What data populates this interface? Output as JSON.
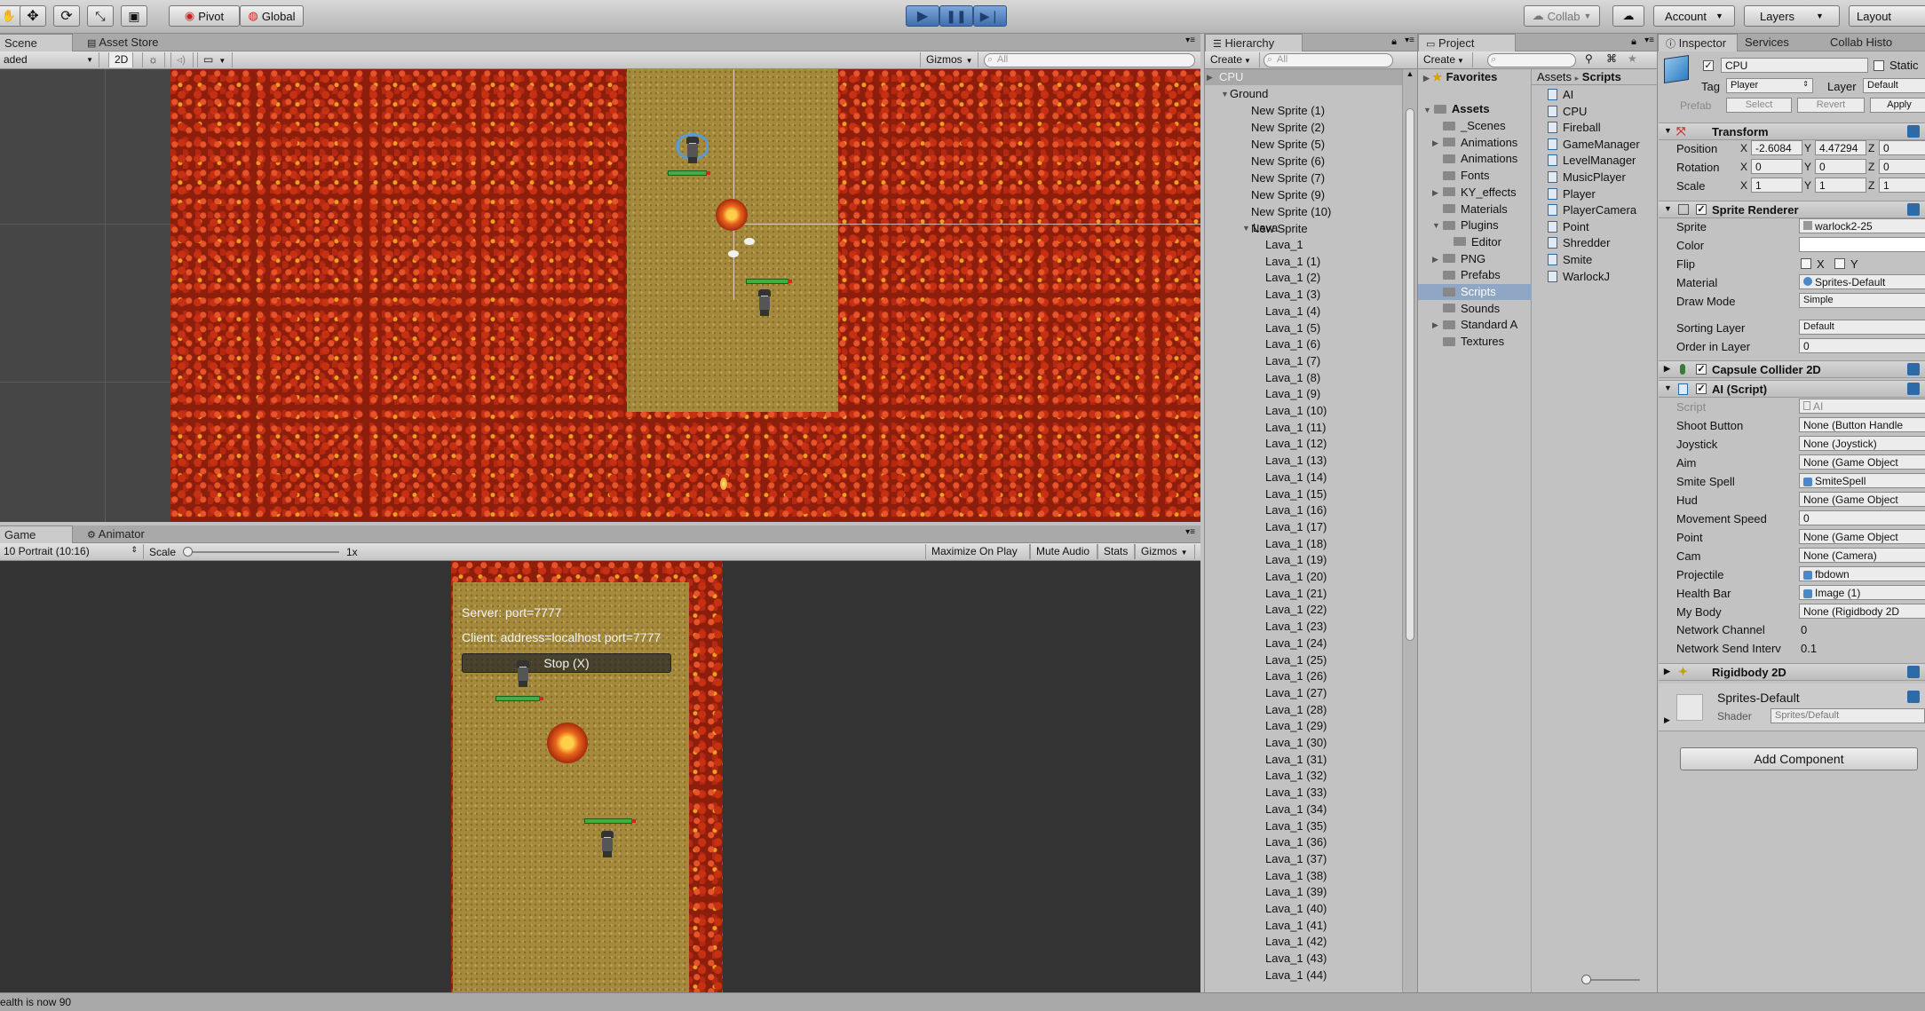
{
  "toolbar": {
    "pivot": "Pivot",
    "global": "Global",
    "collab": "Collab",
    "account": "Account",
    "layers": "Layers",
    "layout": "Layout"
  },
  "scene": {
    "tab_scene": "Scene",
    "tab_asset_store": "Asset Store",
    "shading_mode": "aded",
    "btn_2d": "2D",
    "gizmos": "Gizmos",
    "search_placeholder": "All"
  },
  "game": {
    "tab_game": "Game",
    "tab_animator": "Animator",
    "resolution": "10 Portrait (10:16)",
    "scale_label": "Scale",
    "scale_value": "1x",
    "maximize": "Maximize On Play",
    "mute": "Mute Audio",
    "stats": "Stats",
    "gizmos": "Gizmos",
    "server_text": "Server: port=7777",
    "client_text": "Client: address=localhost port=7777",
    "stop_button": "Stop (X)"
  },
  "hierarchy": {
    "tab": "Hierarchy",
    "create": "Create",
    "search_placeholder": "All",
    "cpu": "CPU",
    "ground": "Ground",
    "ground_items": [
      "New Sprite (1)",
      "New Sprite (2)",
      "New Sprite (5)",
      "New Sprite (6)",
      "New Sprite (7)",
      "New Sprite (9)",
      "New Sprite (10)",
      "New Sprite"
    ],
    "lava": "Lava",
    "lava_items": [
      "Lava_1",
      "Lava_1 (1)",
      "Lava_1 (2)",
      "Lava_1 (3)",
      "Lava_1 (4)",
      "Lava_1 (5)",
      "Lava_1 (6)",
      "Lava_1 (7)",
      "Lava_1 (8)",
      "Lava_1 (9)",
      "Lava_1 (10)",
      "Lava_1 (11)",
      "Lava_1 (12)",
      "Lava_1 (13)",
      "Lava_1 (14)",
      "Lava_1 (15)",
      "Lava_1 (16)",
      "Lava_1 (17)",
      "Lava_1 (18)",
      "Lava_1 (19)",
      "Lava_1 (20)",
      "Lava_1 (21)",
      "Lava_1 (22)",
      "Lava_1 (23)",
      "Lava_1 (24)",
      "Lava_1 (25)",
      "Lava_1 (26)",
      "Lava_1 (27)",
      "Lava_1 (28)",
      "Lava_1 (29)",
      "Lava_1 (30)",
      "Lava_1 (31)",
      "Lava_1 (32)",
      "Lava_1 (33)",
      "Lava_1 (34)",
      "Lava_1 (35)",
      "Lava_1 (36)",
      "Lava_1 (37)",
      "Lava_1 (38)",
      "Lava_1 (39)",
      "Lava_1 (40)",
      "Lava_1 (41)",
      "Lava_1 (42)",
      "Lava_1 (43)",
      "Lava_1 (44)"
    ]
  },
  "project": {
    "tab": "Project",
    "create": "Create",
    "favorites": "Favorites",
    "assets": "Assets",
    "breadcrumb_assets": "Assets",
    "breadcrumb_sep": "▸",
    "breadcrumb_scripts": "Scripts",
    "folders": [
      "_Scenes",
      "Animations",
      "Animations",
      "Fonts",
      "KY_effects",
      "Materials",
      "Plugins",
      "Editor",
      "PNG",
      "Prefabs",
      "Scripts",
      "Sounds",
      "Standard A",
      "Textures"
    ],
    "scripts": [
      "AI",
      "CPU",
      "Fireball",
      "GameManager",
      "LevelManager",
      "MusicPlayer",
      "Player",
      "PlayerCamera",
      "Point",
      "Shredder",
      "Smite",
      "WarlockJ"
    ]
  },
  "inspector": {
    "tab": "Inspector",
    "tab_services": "Services",
    "tab_collab": "Collab Histo",
    "object_name": "CPU",
    "static": "Static",
    "tag_label": "Tag",
    "tag_value": "Player",
    "layer_label": "Layer",
    "layer_value": "Default",
    "prefab_label": "Prefab",
    "prefab_select": "Select",
    "prefab_revert": "Revert",
    "prefab_apply": "Apply",
    "transform": {
      "title": "Transform",
      "position_label": "Position",
      "rotation_label": "Rotation",
      "scale_label": "Scale",
      "x": "X",
      "y": "Y",
      "z": "Z",
      "pos_x": "-2.6084",
      "pos_y": "4.47294",
      "pos_z": "0",
      "rot_x": "0",
      "rot_y": "0",
      "rot_z": "0",
      "scl_x": "1",
      "scl_y": "1",
      "scl_z": "1"
    },
    "sprite_renderer": {
      "title": "Sprite Renderer",
      "sprite_label": "Sprite",
      "sprite_value": "warlock2-25",
      "color_label": "Color",
      "flip_label": "Flip",
      "flip_x": "X",
      "flip_y": "Y",
      "material_label": "Material",
      "material_value": "Sprites-Default",
      "draw_mode_label": "Draw Mode",
      "draw_mode_value": "Simple",
      "sorting_layer_label": "Sorting Layer",
      "sorting_layer_value": "Default",
      "order_label": "Order in Layer",
      "order_value": "0"
    },
    "capsule_collider": {
      "title": "Capsule Collider 2D"
    },
    "ai_script": {
      "title": "AI (Script)",
      "script_label": "Script",
      "script_value": "AI",
      "fields": [
        {
          "label": "Shoot Button",
          "value": "None (Button Handle"
        },
        {
          "label": "Joystick",
          "value": "None (Joystick)"
        },
        {
          "label": "Aim",
          "value": "None (Game Object"
        },
        {
          "label": "Smite Spell",
          "value": "SmiteSpell"
        },
        {
          "label": "Hud",
          "value": "None (Game Object"
        },
        {
          "label": "Movement Speed",
          "value": "0"
        },
        {
          "label": "Point",
          "value": "None (Game Object"
        },
        {
          "label": "Cam",
          "value": "None (Camera)"
        },
        {
          "label": "Projectile",
          "value": "fbdown"
        },
        {
          "label": "Health Bar",
          "value": "Image (1)"
        },
        {
          "label": "My Body",
          "value": "None (Rigidbody 2D"
        }
      ],
      "network_channel_label": "Network Channel",
      "network_channel_value": "0",
      "network_send_label": "Network Send Interv",
      "network_send_value": "0.1"
    },
    "rigidbody": {
      "title": "Rigidbody 2D"
    },
    "material": {
      "name": "Sprites-Default",
      "shader_label": "Shader",
      "shader_value": "Sprites/Default"
    },
    "add_component": "Add Component"
  },
  "status_bar": {
    "message": "ealth is now 90"
  },
  "colors": {
    "selection": "#8fa6c4",
    "panel_bg": "#c2c2c2",
    "lava": "#8e1e0c",
    "ground": "#a48a3c"
  }
}
